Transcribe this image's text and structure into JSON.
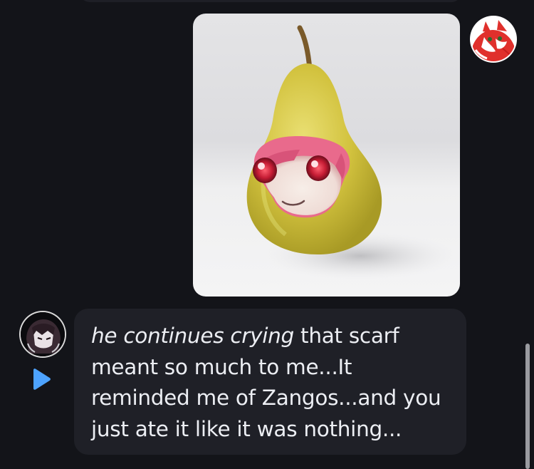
{
  "message": {
    "italic_text": "he continues crying",
    "text": " that scarf meant so much to me...It reminded me of Zangos...and you just ate it like it was nothing..."
  },
  "icons": {
    "play": "play-icon",
    "character": "pear-with-face-image",
    "avatar_right": "red-fox-avatar",
    "avatar_left": "dark-haired-character-avatar"
  },
  "colors": {
    "background": "#131419",
    "bubble": "#1f2027",
    "text": "#eceef3",
    "play_icon": "#4da3ff",
    "pear": "#d7c74a"
  }
}
